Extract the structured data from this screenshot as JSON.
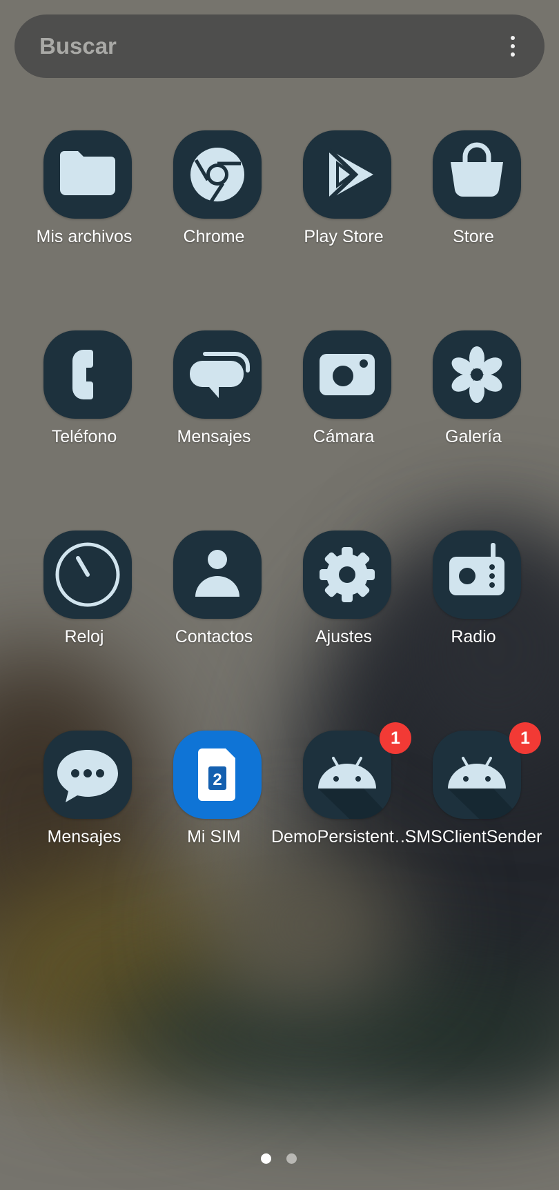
{
  "search": {
    "placeholder": "Buscar",
    "more_icon": "more-vert-icon"
  },
  "apps": [
    {
      "label": "Mis archivos",
      "icon": "folder-icon"
    },
    {
      "label": "Chrome",
      "icon": "chrome-icon"
    },
    {
      "label": "Play Store",
      "icon": "play-store-icon"
    },
    {
      "label": "Store",
      "icon": "shopping-bag-icon"
    },
    {
      "label": "Teléfono",
      "icon": "phone-icon"
    },
    {
      "label": "Mensajes",
      "icon": "chat-bubbles-icon"
    },
    {
      "label": "Cámara",
      "icon": "camera-icon"
    },
    {
      "label": "Galería",
      "icon": "flower-icon"
    },
    {
      "label": "Reloj",
      "icon": "clock-icon"
    },
    {
      "label": "Contactos",
      "icon": "person-icon"
    },
    {
      "label": "Ajustes",
      "icon": "gear-icon"
    },
    {
      "label": "Radio",
      "icon": "radio-icon"
    },
    {
      "label": "Mensajes",
      "icon": "message-bubble-icon"
    },
    {
      "label": "Mi SIM",
      "icon": "sim-card-icon",
      "sim_number": "2"
    },
    {
      "label": "DemoPersistentService",
      "icon": "android-icon",
      "badge": "1"
    },
    {
      "label": "SMSClientSender",
      "icon": "android-icon",
      "badge": "1"
    }
  ],
  "page_indicator": {
    "pages": 2,
    "current": 1
  },
  "colors": {
    "icon_background": "#1d313d",
    "icon_glyph": "#d1e4ee",
    "sim_background": "#0f74d6",
    "badge": "#f23a35"
  }
}
